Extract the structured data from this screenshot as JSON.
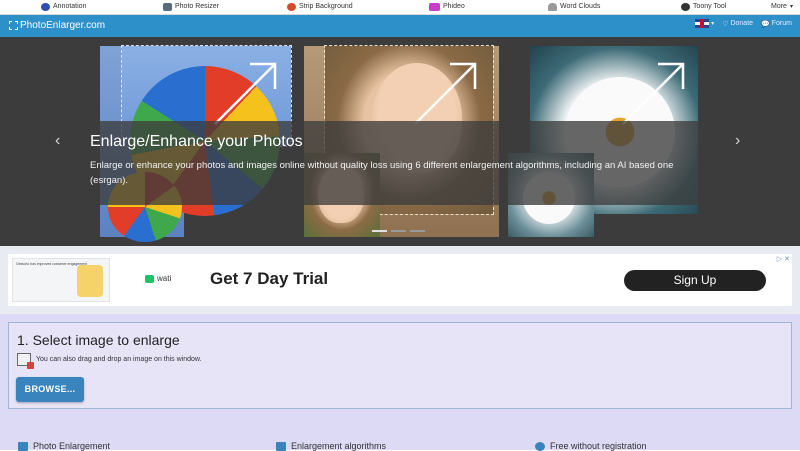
{
  "topbar": {
    "links": [
      {
        "label": "Annotation",
        "icon": "annotation-icon",
        "color": "#2b4fb0"
      },
      {
        "label": "Photo Resizer",
        "icon": "photo-resizer-icon",
        "color": "#5a6b7c"
      },
      {
        "label": "Strip Background",
        "icon": "strip-background-icon",
        "color": "#d84a2c"
      },
      {
        "label": "Phideo",
        "icon": "phideo-icon",
        "color": "#c53fc9"
      },
      {
        "label": "Word Clouds",
        "icon": "word-clouds-icon",
        "color": "#7a7a7a"
      },
      {
        "label": "Toony Tool",
        "icon": "toony-tool-icon",
        "color": "#333333"
      }
    ],
    "more_label": "More"
  },
  "header": {
    "logo_text": "PhotoEnlarger.com",
    "donate_label": "Donate",
    "forum_label": "Forum",
    "color": "#2e90c8"
  },
  "hero": {
    "title": "Enlarge/Enhance your Photos",
    "text": "Enlarge or enhance your photos and images online without quality loss using 6 different enlargement algorithms, including an AI based one (esrgan).",
    "prev_arrow": "‹",
    "next_arrow": "›"
  },
  "ad": {
    "thumb_text": "Gestorio has improved customer engagement",
    "brand": "wati",
    "headline": "Get 7 Day Trial",
    "cta": "Sign Up"
  },
  "select": {
    "title": "1. Select image to enlarge",
    "hint": "You can also drag and drop an image on this window.",
    "browse_label": "BROWSE..."
  },
  "features": [
    {
      "label": "Photo Enlargement"
    },
    {
      "label": "Enlargement algorithms"
    },
    {
      "label": "Free without registration"
    }
  ]
}
